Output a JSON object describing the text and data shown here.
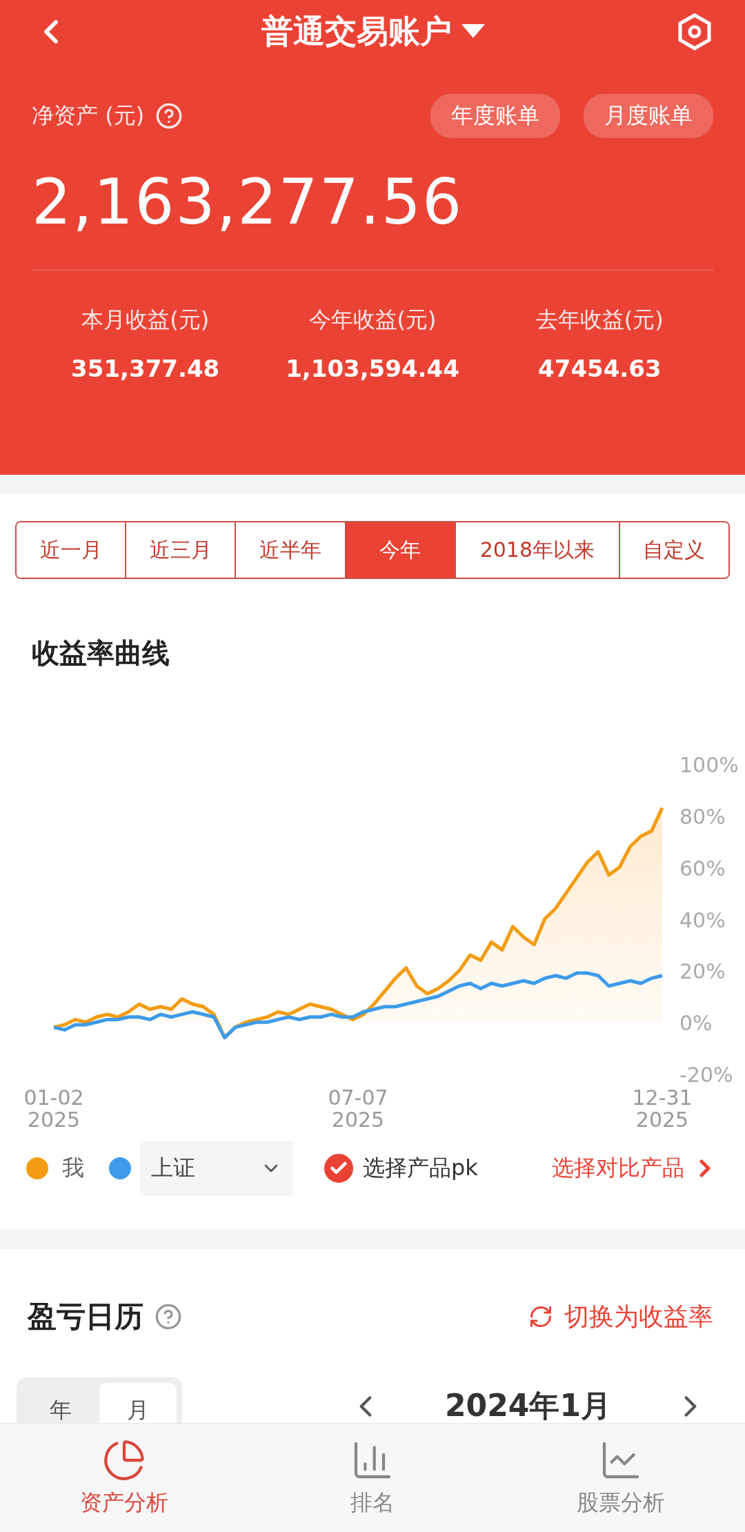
{
  "header": {
    "title": "普通交易账户"
  },
  "net_assets": {
    "label": "净资产 (元)",
    "value": "2,163,277.56",
    "buttons": [
      "年度账单",
      "月度账单"
    ]
  },
  "stats": [
    {
      "label": "本月收益(元)",
      "value": "351,377.48"
    },
    {
      "label": "今年收益(元)",
      "value": "1,103,594.44"
    },
    {
      "label": "去年收益(元)",
      "value": "47454.63"
    }
  ],
  "period_tabs": [
    {
      "label": "近一月",
      "selected": false
    },
    {
      "label": "近三月",
      "selected": false
    },
    {
      "label": "近半年",
      "selected": false
    },
    {
      "label": "今年",
      "selected": true
    },
    {
      "label": "2018年以来",
      "selected": false
    },
    {
      "label": "自定义",
      "selected": false
    }
  ],
  "chart_section": {
    "title": "收益率曲线",
    "x_labels": [
      "01-02 2025",
      "07-07 2025",
      "12-31 2025"
    ],
    "chart_data": {
      "type": "line",
      "ylim": [
        -20,
        100
      ],
      "yticks": [
        {
          "value": 100,
          "label": "100%"
        },
        {
          "value": 80,
          "label": "80%"
        },
        {
          "value": 60,
          "label": "60%"
        },
        {
          "value": 40,
          "label": "40%"
        },
        {
          "value": 20,
          "label": "20%"
        },
        {
          "value": 0,
          "label": "0%"
        },
        {
          "value": -20,
          "label": "-20%"
        }
      ],
      "series": [
        {
          "name": "我",
          "type": "area",
          "color": "#f39c12",
          "values": [
            -2,
            -1,
            1,
            0,
            2,
            3,
            2,
            4,
            7,
            5,
            6,
            5,
            9,
            7,
            6,
            3,
            -6,
            -2,
            0,
            1,
            2,
            4,
            3,
            5,
            7,
            6,
            5,
            3,
            1,
            3,
            7,
            12,
            17,
            21,
            14,
            11,
            13,
            16,
            20,
            26,
            24,
            31,
            28,
            37,
            33,
            30,
            40,
            44,
            50,
            56,
            62,
            66,
            57,
            60,
            68,
            72,
            74,
            83
          ]
        },
        {
          "name": "上证",
          "color": "#3d9be9",
          "values": [
            -2,
            -3,
            -1,
            -1,
            0,
            1,
            1,
            2,
            2,
            1,
            3,
            2,
            3,
            4,
            3,
            2,
            -6,
            -2,
            -1,
            0,
            0,
            1,
            2,
            1,
            2,
            2,
            3,
            2,
            2,
            4,
            5,
            6,
            6,
            7,
            8,
            9,
            10,
            12,
            14,
            15,
            13,
            15,
            14,
            15,
            16,
            15,
            17,
            18,
            17,
            19,
            19,
            18,
            14,
            15,
            16,
            15,
            17,
            18
          ]
        }
      ]
    }
  },
  "legend": {
    "pk": {
      "label": "选择产品pk",
      "checked": true
    },
    "compare_link": "选择对比产品"
  },
  "calendar": {
    "title": "盈亏日历",
    "switch": "切换为收益率",
    "mode_tabs": [
      {
        "label": "年",
        "selected": false
      },
      {
        "label": "月",
        "selected": true
      }
    ],
    "month": "2024年1月"
  },
  "bottom_nav": [
    {
      "label": "资产分析",
      "selected": true
    },
    {
      "label": "排名",
      "selected": false
    },
    {
      "label": "股票分析",
      "selected": false
    }
  ]
}
